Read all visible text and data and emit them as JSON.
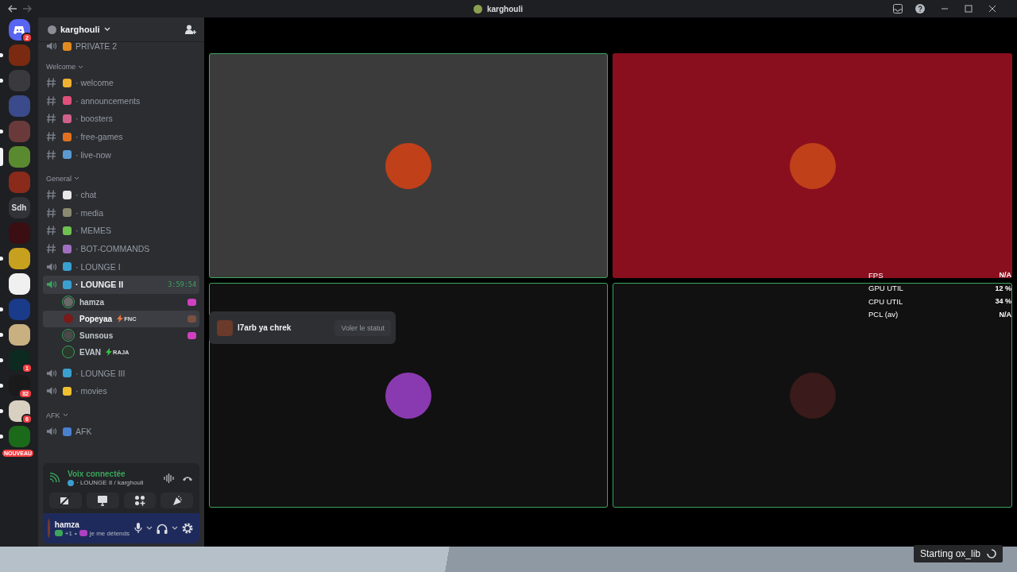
{
  "window": {
    "title": "karghouli"
  },
  "servers": [
    {
      "kind": "home",
      "badge": "2",
      "unread": false,
      "selected": false,
      "color": "#5865f2"
    },
    {
      "kind": "image",
      "unread": true,
      "selected": false,
      "color": "#7a2a10"
    },
    {
      "kind": "image",
      "unread": true,
      "selected": false,
      "color": "#3a3a3e"
    },
    {
      "kind": "image",
      "unread": false,
      "selected": false,
      "color": "#3a4a8a"
    },
    {
      "kind": "image",
      "unread": true,
      "selected": false,
      "color": "#6a3a3a"
    },
    {
      "kind": "image",
      "unread": false,
      "selected": true,
      "color": "#5a8a30"
    },
    {
      "kind": "image",
      "unread": false,
      "selected": false,
      "color": "#8a2a1a"
    },
    {
      "kind": "text",
      "label": "Sdh",
      "unread": false,
      "selected": false,
      "color": "#313338"
    },
    {
      "kind": "image",
      "unread": false,
      "selected": false,
      "color": "#3a0e12"
    },
    {
      "kind": "image",
      "unread": true,
      "selected": false,
      "color": "#c8a020"
    },
    {
      "kind": "image",
      "unread": false,
      "selected": false,
      "color": "#f0f0f0"
    },
    {
      "kind": "image",
      "unread": true,
      "selected": false,
      "color": "#1a3a8a"
    },
    {
      "kind": "image",
      "unread": true,
      "selected": false,
      "color": "#c8b080"
    },
    {
      "kind": "image",
      "badge": "1",
      "unread": true,
      "selected": false,
      "color": "#0d2a20"
    },
    {
      "kind": "image",
      "badge": "82",
      "unread": true,
      "selected": false,
      "color": "#1a1a1a"
    },
    {
      "kind": "image",
      "badge": "6",
      "unread": true,
      "selected": false,
      "color": "#d8d0c0"
    },
    {
      "kind": "image",
      "pill": "NOUVEAU",
      "unread": true,
      "selected": false,
      "color": "#1a6a1a"
    }
  ],
  "guild": {
    "name": "karghouli"
  },
  "channels": [
    {
      "kind": "voice",
      "name": "PRIVATE 2",
      "color": "#e08a20",
      "connected": false
    },
    {
      "kind": "category",
      "name": "Welcome",
      "expanded": true
    },
    {
      "kind": "text",
      "name": "· welcome",
      "color": "#f0b030"
    },
    {
      "kind": "text",
      "name": "· announcements",
      "color": "#e0507a"
    },
    {
      "kind": "text",
      "name": "· boosters",
      "color": "#d0608a"
    },
    {
      "kind": "text",
      "name": "· free-games",
      "color": "#e07020"
    },
    {
      "kind": "text",
      "name": "· live-now",
      "color": "#5a9ad0"
    },
    {
      "kind": "category",
      "name": "General",
      "expanded": true
    },
    {
      "kind": "text",
      "name": "· chat",
      "color": "#e8e8e8"
    },
    {
      "kind": "text",
      "name": "· media",
      "color": "#8a8a70"
    },
    {
      "kind": "text",
      "name": "· MEMES",
      "color": "#70c050"
    },
    {
      "kind": "text",
      "name": "· BOT-COMMANDS",
      "color": "#a070c0"
    },
    {
      "kind": "voice",
      "name": "· LOUNGE I",
      "color": "#3aa0d0",
      "connected": false
    },
    {
      "kind": "voice",
      "name": "· LOUNGE II",
      "color": "#3aa0d0",
      "connected": true,
      "timer": "3:59:54",
      "members": [
        {
          "name": "hamza",
          "speaking": true,
          "hovered": false,
          "avatar": {
            "color": "#6a6a6a"
          },
          "activity": {
            "color": "#d040c0"
          }
        },
        {
          "name": "Popeyaa",
          "tag": {
            "text": "FNC",
            "color": "#e8743b"
          },
          "speaking": false,
          "hovered": true,
          "avatar": {
            "color": "#7a1a1a"
          },
          "activity": {
            "color": "#7a5040"
          }
        },
        {
          "name": "Sunsous",
          "speaking": true,
          "hovered": false,
          "avatar": {
            "color": "#4a4a4a"
          },
          "activity": {
            "color": "#d040c0"
          }
        },
        {
          "name": "EVAN",
          "tag": {
            "text": "RAJA",
            "color": "#3ac040"
          },
          "speaking": true,
          "hovered": false,
          "avatar": {
            "color": "#2a3a2a"
          }
        }
      ]
    },
    {
      "kind": "voice",
      "name": "· LOUNGE III",
      "color": "#3aa0d0",
      "connected": false
    },
    {
      "kind": "voice",
      "name": "· movies",
      "color": "#f0c030",
      "connected": false
    },
    {
      "kind": "category",
      "name": "AFK",
      "expanded": true
    },
    {
      "kind": "voice",
      "name": "AFK",
      "color": "#4a80d0",
      "connected": false
    }
  ],
  "voice_panel": {
    "status": "Voix connectée",
    "channel": "· LOUNGE II / karghouli"
  },
  "user": {
    "name": "hamza",
    "extra": "+1",
    "separator": "•",
    "status": "je me détends"
  },
  "tiles": [
    {
      "color": "#3b3b3b",
      "speaking": true,
      "avatar": {
        "color": "#c0401a"
      }
    },
    {
      "color": "#8a0f1e",
      "speaking": false,
      "avatar": {
        "color": "#c0401a"
      }
    },
    {
      "color": "#111111",
      "speaking": true,
      "avatar": {
        "color": "#8a3ab0"
      }
    },
    {
      "color": "#111111",
      "speaking": true,
      "avatar": {
        "color": "#3a1a1a"
      }
    }
  ],
  "tooltip": {
    "name": "l7arb ya chrek",
    "action": "Voler le statut"
  },
  "overlay": [
    {
      "label": "FPS",
      "value": "N/A"
    },
    {
      "label": "GPU UTIL",
      "value": "12 %"
    },
    {
      "label": "CPU UTIL",
      "value": "34 %"
    },
    {
      "label": "PCL (av)",
      "value": "N/A"
    }
  ],
  "toast": {
    "text": "Starting ox_lib"
  }
}
